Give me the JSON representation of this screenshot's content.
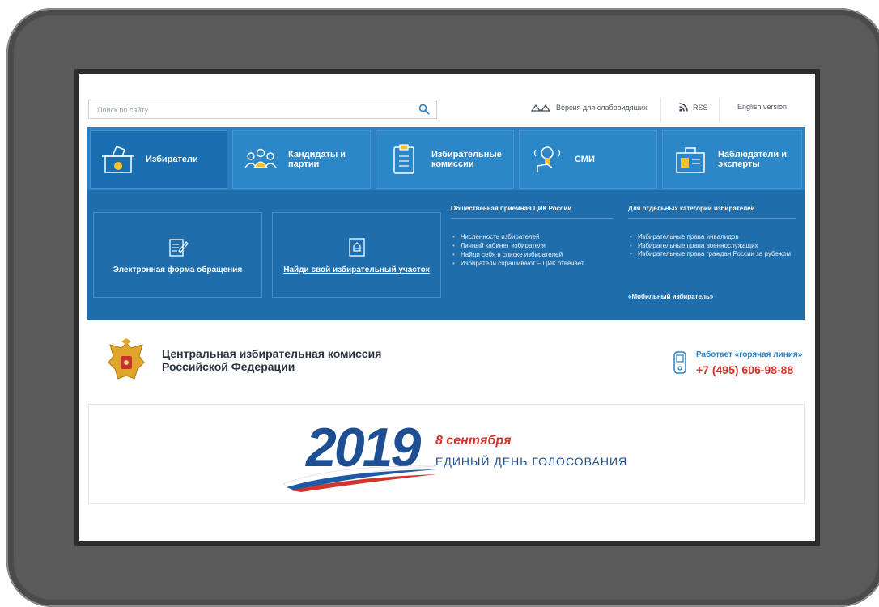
{
  "search": {
    "placeholder": "Поиск по сайту"
  },
  "header_links": {
    "accessibility": "Версия для слабовидящих",
    "rss": "RSS",
    "english": "English version"
  },
  "nav": {
    "tabs": [
      {
        "label": "Избиратели",
        "icon": "ballot-box-icon",
        "active": true
      },
      {
        "label": "Кандидаты и\nпартии",
        "icon": "people-icon"
      },
      {
        "label": "Избирательные\nкомиссии",
        "icon": "clipboard-icon"
      },
      {
        "label": "СМИ",
        "icon": "microphone-icon"
      },
      {
        "label": "Наблюдатели и\nэксперты",
        "icon": "badge-icon"
      }
    ]
  },
  "panel": {
    "cards": [
      {
        "label": "Электронная форма обращения",
        "icon": "edit-form-icon"
      },
      {
        "label": "Найди свой избирательный участок",
        "icon": "polling-station-icon"
      }
    ],
    "reception": {
      "title": "Общественная приемная ЦИК России",
      "items": [
        "Численность избирателей",
        "Личный кабинет избирателя",
        "Найди себя в списке избирателей",
        "Избиратели спрашивают – ЦИК отвечает"
      ]
    },
    "categories": {
      "title": "Для отдельных категорий избирателей",
      "items": [
        "Избирательные права инвалидов",
        "Избирательные права военнослужащих",
        "Избирательные права граждан России за рубежом"
      ]
    },
    "mobile": "«Мобильный избиратель»"
  },
  "org": {
    "line1": "Центральная избирательная комиссия",
    "line2": "Российской Федерации"
  },
  "hotline": {
    "label": "Работает «горячая линия»",
    "phone": "+7 (495) 606-98-88"
  },
  "banner": {
    "year": "2019",
    "date": "8 сентября",
    "subtitle": "ЕДИНЫЙ ДЕНЬ ГОЛОСОВАНИЯ"
  },
  "colors": {
    "nav_blue": "#2a80c2",
    "panel_blue": "#1f6eab",
    "phone_red": "#d0342c",
    "org_text": "#2b3440"
  }
}
